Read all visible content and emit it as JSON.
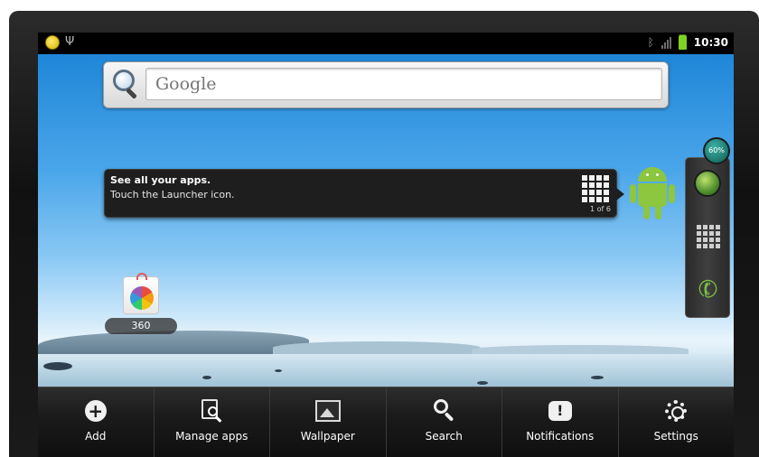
{
  "status_bar": {
    "notification_icon": "notification-dot-icon",
    "usb_icon": "usb-icon",
    "bluetooth_icon": "bluetooth-icon",
    "signal_icon": "signal-icon",
    "battery_icon": "battery-icon",
    "time": "10:30"
  },
  "search_widget": {
    "placeholder": "Google",
    "icon": "search-icon"
  },
  "tip": {
    "title": "See all your apps.",
    "body": "Touch the Launcher icon.",
    "page": "1 of 6",
    "icon": "launcher-grid-icon"
  },
  "dock": {
    "badge": "60%",
    "items": [
      "browser-globe-icon",
      "launcher-grid-icon",
      "phone-icon"
    ]
  },
  "shortcut": {
    "label": "360",
    "icon": "app-360-icon"
  },
  "menu": {
    "items": [
      {
        "label": "Add",
        "icon": "add-icon"
      },
      {
        "label": "Manage apps",
        "icon": "manage-apps-icon"
      },
      {
        "label": "Wallpaper",
        "icon": "wallpaper-icon"
      },
      {
        "label": "Search",
        "icon": "search-icon"
      },
      {
        "label": "Notifications",
        "icon": "notifications-icon"
      },
      {
        "label": "Settings",
        "icon": "settings-icon"
      }
    ]
  },
  "colors": {
    "battery": "#7ed321",
    "android_green": "#8dc63f",
    "sky": "#1f86d8"
  }
}
